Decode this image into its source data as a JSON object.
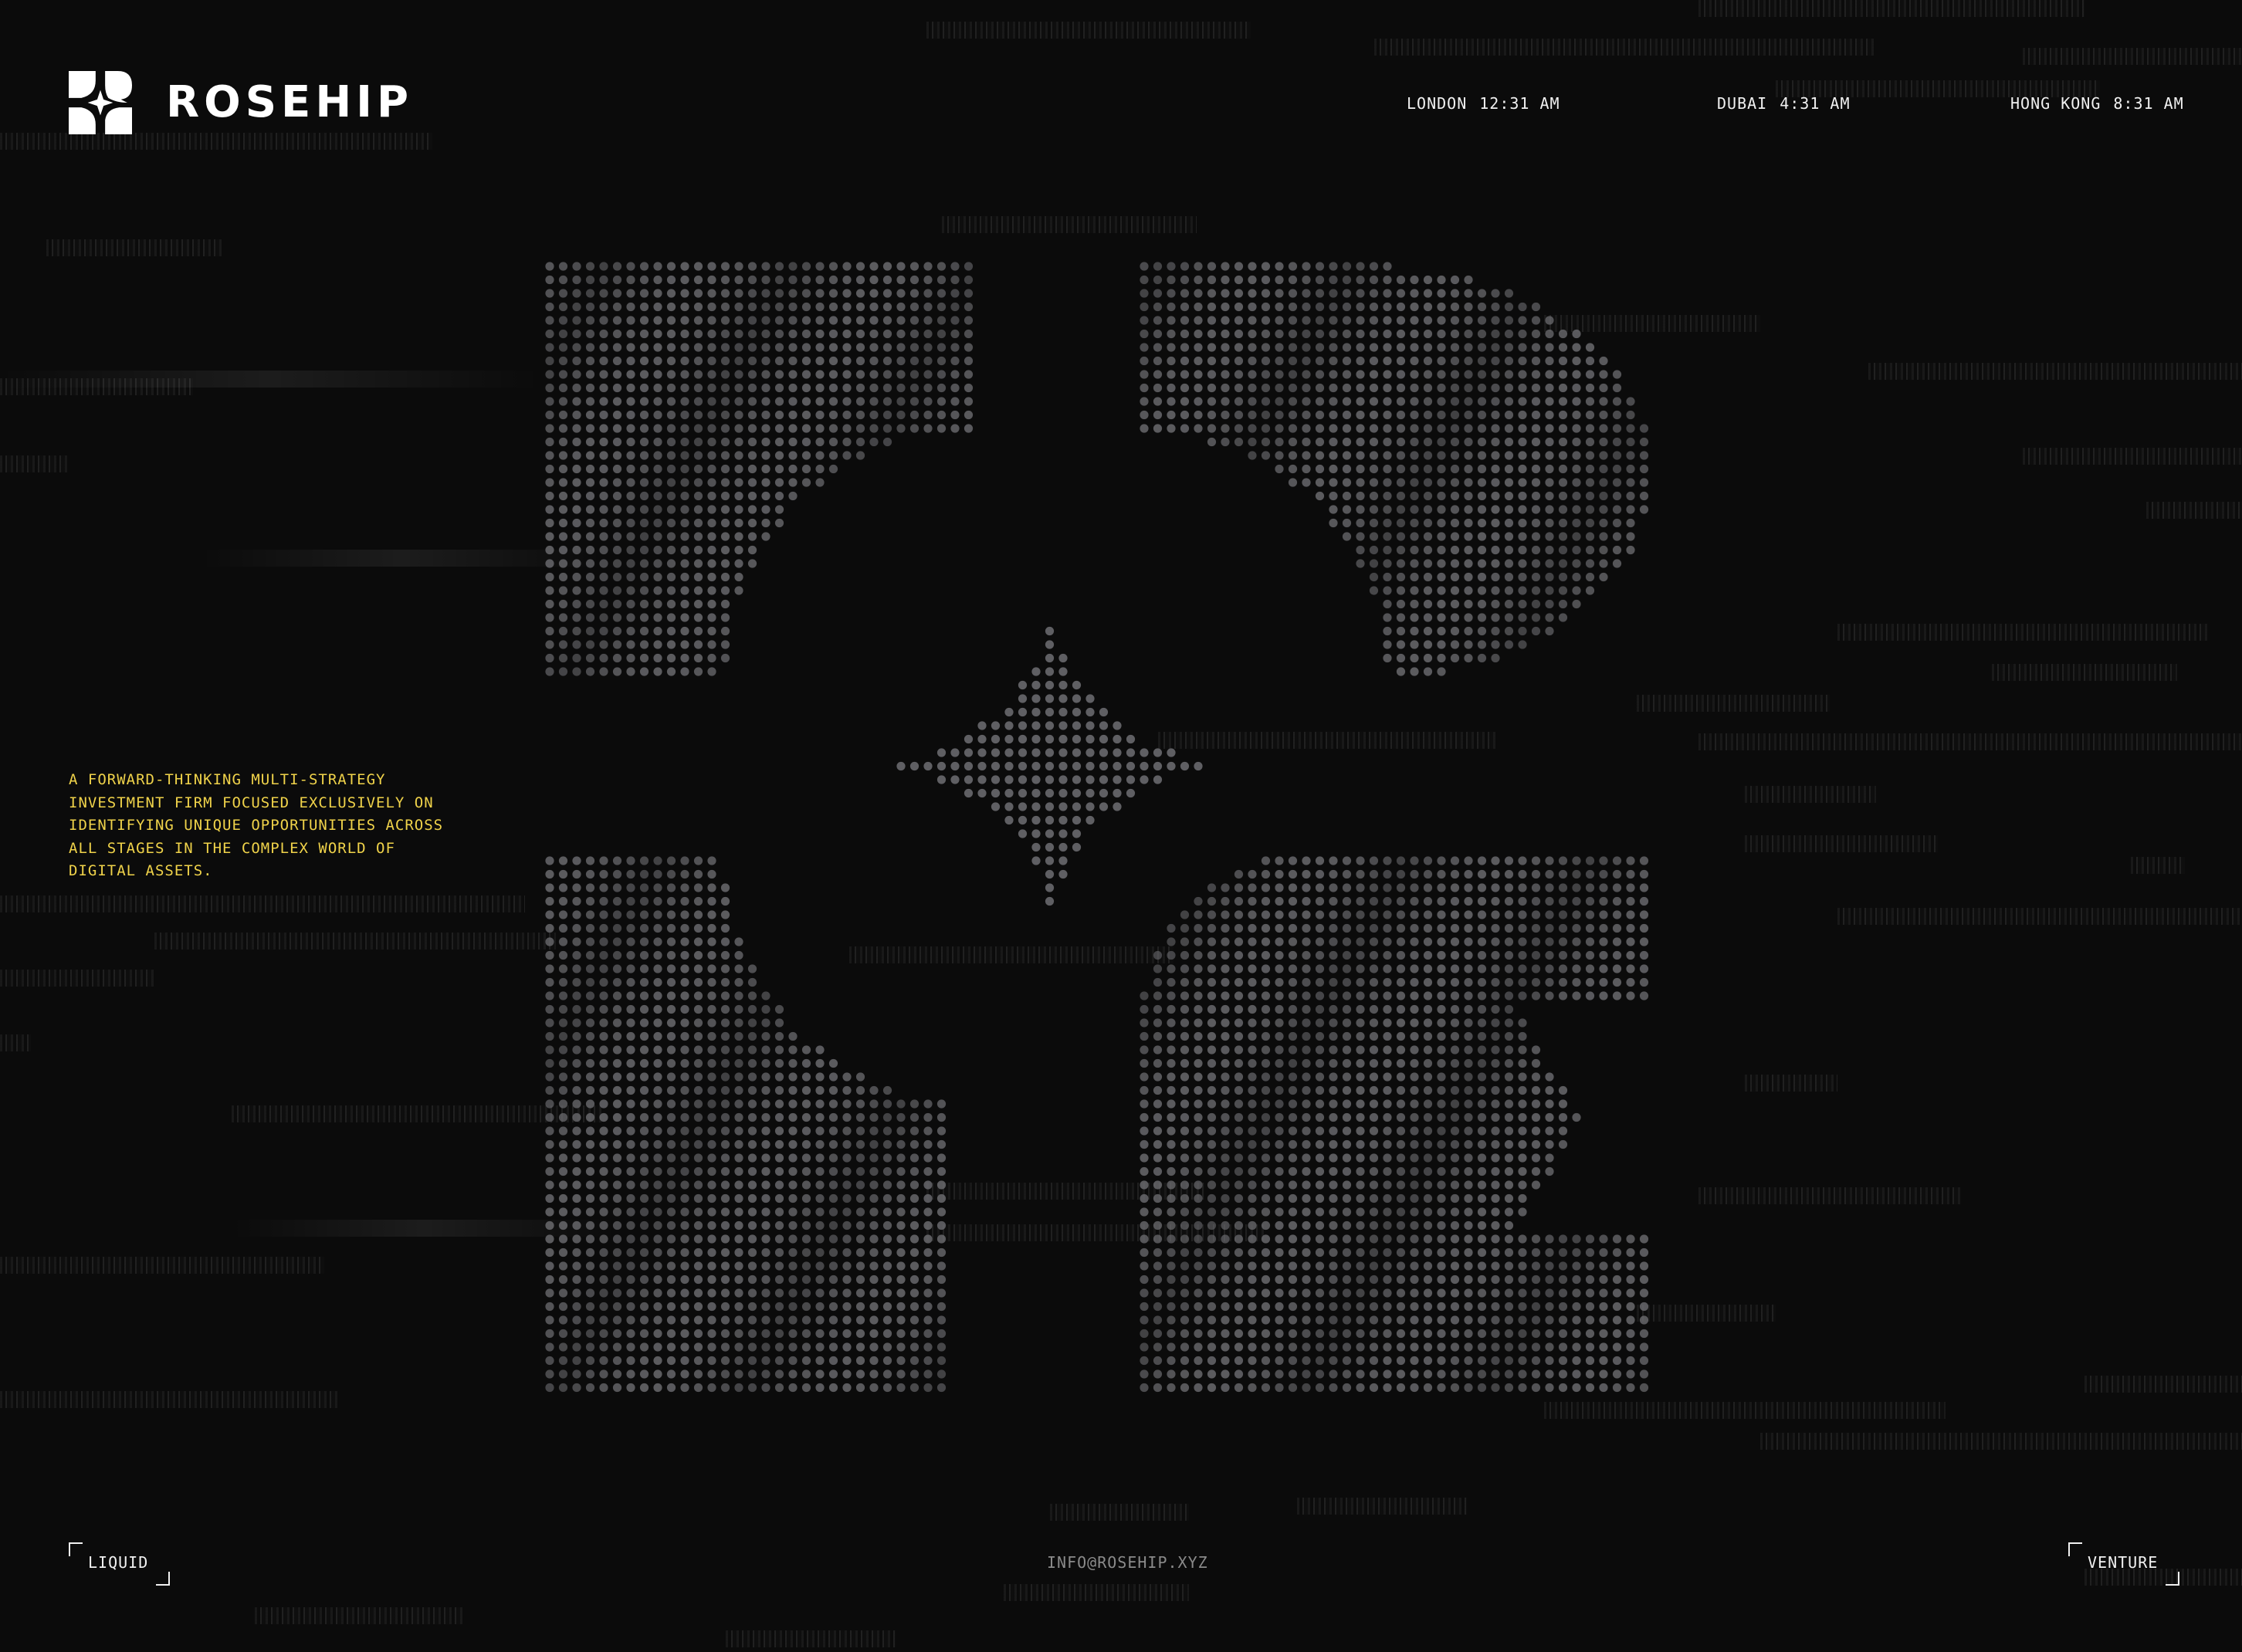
{
  "brand": {
    "name": "ROSEHIP",
    "logo_icon": "rosehip-star-logo-icon"
  },
  "clocks": [
    {
      "city": "LONDON",
      "time": "12:31 AM"
    },
    {
      "city": "DUBAI",
      "time": "4:31 AM"
    },
    {
      "city": "HONG KONG",
      "time": "8:31 AM"
    }
  ],
  "hero": {
    "tagline": "A FORWARD-THINKING MULTI-STRATEGY INVESTMENT FIRM FOCUSED EXCLUSIVELY ON IDENTIFYING UNIQUE OPPORTUNITIES ACROSS ALL STAGES IN THE COMPLEX WORLD OF DIGITAL ASSETS.",
    "background_graphic": "dotted-rosehip-monogram"
  },
  "footer": {
    "left_link": "LIQUID",
    "email": "INFO@ROSEHIP.XYZ",
    "right_link": "VENTURE"
  },
  "colors": {
    "background": "#0b0b0b",
    "accent_yellow": "#f0d34a",
    "text": "#f1f1f1",
    "muted": "#8a8a8a",
    "dot": "#6f6f73"
  }
}
